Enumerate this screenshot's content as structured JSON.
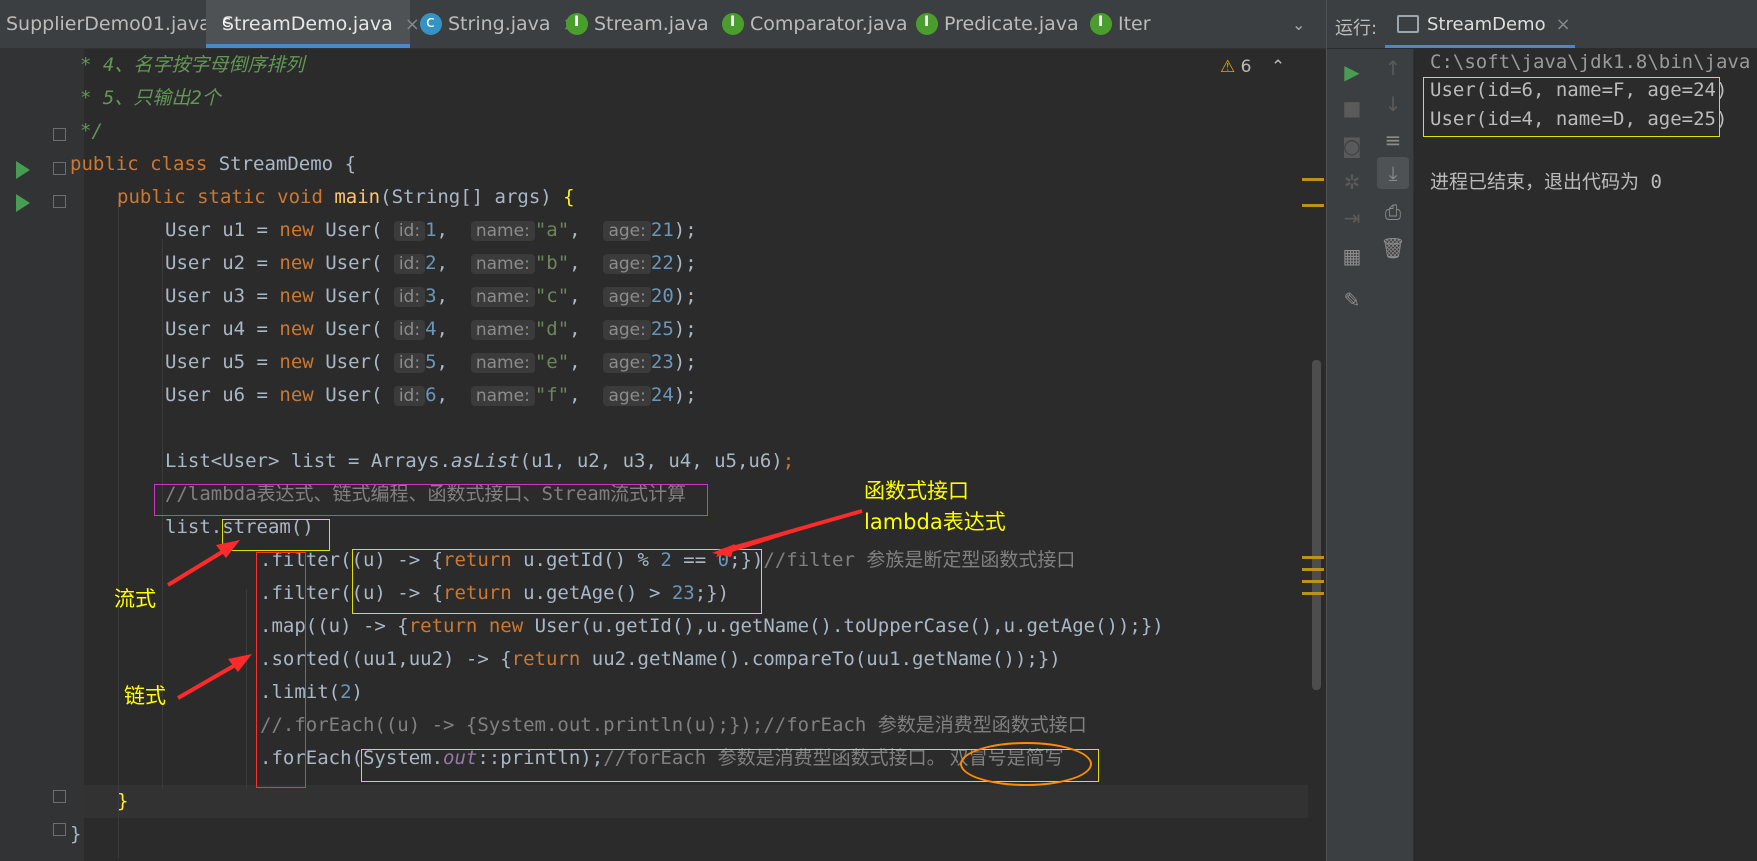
{
  "editor_tabs": [
    {
      "label": "SupplierDemo01.java",
      "icon": "class-icon"
    },
    {
      "label": "StreamDemo.java",
      "icon": "class-icon"
    },
    {
      "label": "String.java",
      "icon": "class-icon"
    },
    {
      "label": "Stream.java",
      "icon": "interface-icon"
    },
    {
      "label": "Comparator.java",
      "icon": "interface-icon"
    },
    {
      "label": "Predicate.java",
      "icon": "interface-icon"
    },
    {
      "label": "Iter",
      "icon": "interface-icon"
    }
  ],
  "active_tab": "StreamDemo.java",
  "inspection": {
    "icon": "warning-icon",
    "count": "6"
  },
  "code": {
    "doc4": "* 4、名字按字母倒序排列",
    "doc5": "* 5、只输出2个",
    "doc_end": "*/",
    "class_kw": "public class",
    "class_name": "StreamDemo",
    "main_kw": "public static void",
    "main_name": "main",
    "main_params": "(String[] args)",
    "users": [
      {
        "var": "u1",
        "id": "1",
        "name": "\"a\"",
        "age": "21"
      },
      {
        "var": "u2",
        "id": "2",
        "name": "\"b\"",
        "age": "22"
      },
      {
        "var": "u3",
        "id": "3",
        "name": "\"c\"",
        "age": "20"
      },
      {
        "var": "u4",
        "id": "4",
        "name": "\"d\"",
        "age": "25"
      },
      {
        "var": "u5",
        "id": "5",
        "name": "\"e\"",
        "age": "23"
      },
      {
        "var": "u6",
        "id": "6",
        "name": "\"f\"",
        "age": "24"
      }
    ],
    "hint_id": "id:",
    "hint_name": "name:",
    "hint_age": "age:",
    "list_decl": "List<User> list = Arrays.",
    "list_aslist": "asList",
    "list_args": "(u1, u2, u3, u4, u5,u6)",
    "comment_lambda": "//lambda表达式、链式编程、函数式接口、Stream流式计算",
    "stream_prefix": "list.",
    "stream_call": "stream()",
    "filter1_a": ".filter(",
    "filter1_b": "(u) -> {",
    "filter1_ret": "return",
    "filter1_c": " u.getId() % ",
    "filter1_n2": "2",
    "filter1_eq": " == ",
    "filter1_n0": "0",
    "filter1_d": ";})",
    "filter1_comment": "//filter 参族是断定型函数式接口",
    "filter2_a": ".filter(",
    "filter2_b": "(u) -> {",
    "filter2_ret": "return",
    "filter2_c": " u.getAge() > ",
    "filter2_n": "23",
    "filter2_d": ";})",
    "map_a": ".map((u) -> {",
    "map_ret": "return",
    "map_new": "new",
    "map_c": " User(u.getId(),u.getName().toUpperCase(),u.getAge());})",
    "sorted_a": ".sorted((uu1,uu2) -> {",
    "sorted_ret": "return",
    "sorted_c": " uu2.getName().compareTo(uu1.getName());})",
    "limit_a": ".limit(",
    "limit_n": "2",
    "limit_b": ")",
    "foreach_comment_line": "//.forEach((u) -> {System.out.println(u);});//forEach 参数是消费型函数式接口",
    "foreach_a": ".forEach(",
    "foreach_sys": "System.",
    "foreach_out": "out",
    "foreach_println": "::println);",
    "foreach_comment": "//forEach 参数是消费型函数式接口。",
    "foreach_circled": "双冒号是简写",
    "close_brace_main": "}",
    "close_brace_class": "}"
  },
  "annotations": {
    "functional_interface": "函数式接口",
    "lambda_expression": "lambda表达式",
    "stream_style": "流式",
    "chain_style": "链式"
  },
  "run_panel": {
    "label": "运行:",
    "tab": "StreamDemo",
    "console": [
      "C:\\soft\\java\\jdk1.8\\bin\\java",
      "User(id=6, name=F, age=24)",
      "User(id=4, name=D, age=25)",
      "",
      "进程已结束，退出代码为 0"
    ]
  },
  "colors": {
    "editor_bg": "#2b2b2b",
    "annotation": "#ffff00",
    "arrow": "#ff2a2a",
    "accent": "#4a88c7"
  }
}
